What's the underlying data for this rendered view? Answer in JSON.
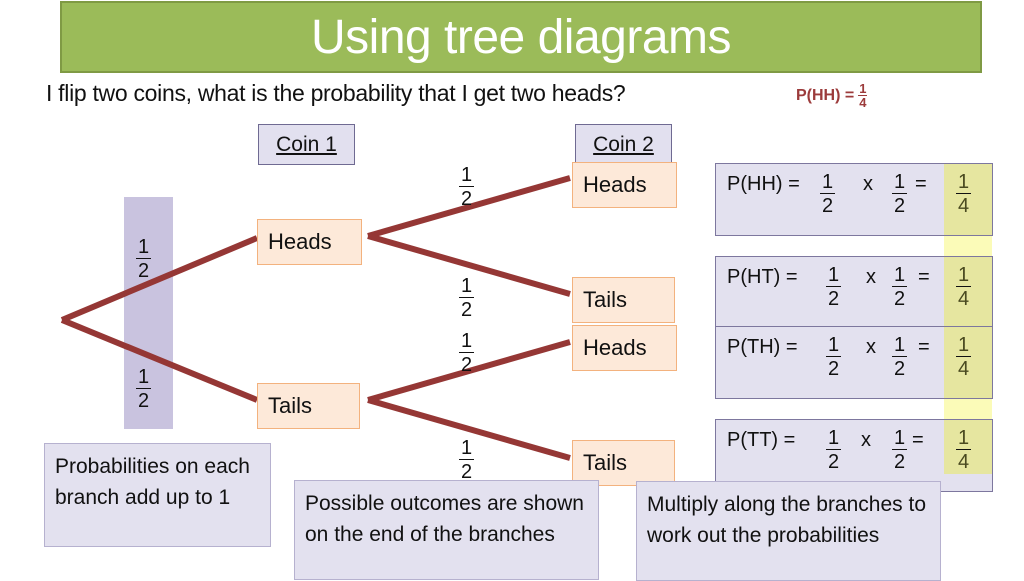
{
  "title": "Using tree diagrams",
  "question": "I flip two coins, what is the probability that I get two heads?",
  "answer": {
    "label": "P(HH) =",
    "numerator": "1",
    "denominator": "4"
  },
  "colors": {
    "banner": "#9bbb59",
    "branch": "#953735",
    "node_fill": "#fde9d9",
    "calc_fill": "#e3e1ef",
    "highlight": "#e6e6a0"
  },
  "coin_labels": {
    "coin1": "Coin 1",
    "coin2": "Coin 2"
  },
  "tree": {
    "first": [
      {
        "label": "Heads",
        "prob": {
          "n": "1",
          "d": "2"
        }
      },
      {
        "label": "Tails",
        "prob": {
          "n": "1",
          "d": "2"
        }
      }
    ],
    "second": [
      {
        "label": "Heads",
        "prob": {
          "n": "1",
          "d": "2"
        }
      },
      {
        "label": "Tails",
        "prob": {
          "n": "1",
          "d": "2"
        }
      },
      {
        "label": "Heads",
        "prob": {
          "n": "1",
          "d": "2"
        }
      },
      {
        "label": "Tails",
        "prob": {
          "n": "1",
          "d": "2"
        }
      }
    ]
  },
  "calculations": [
    {
      "label": "P(HH) =",
      "a": {
        "n": "1",
        "d": "2"
      },
      "op": "x",
      "b": {
        "n": "1",
        "d": "2"
      },
      "eq": "=",
      "result": {
        "n": "1",
        "d": "4"
      }
    },
    {
      "label": "P(HT) =",
      "a": {
        "n": "1",
        "d": "2"
      },
      "op": "x",
      "b": {
        "n": "1",
        "d": "2"
      },
      "eq": "=",
      "result": {
        "n": "1",
        "d": "4"
      }
    },
    {
      "label": "P(TH) =",
      "a": {
        "n": "1",
        "d": "2"
      },
      "op": "x",
      "b": {
        "n": "1",
        "d": "2"
      },
      "eq": "=",
      "result": {
        "n": "1",
        "d": "4"
      }
    },
    {
      "label": "P(TT) =",
      "a": {
        "n": "1",
        "d": "2"
      },
      "op": "x",
      "b": {
        "n": "1",
        "d": "2"
      },
      "eq": "=",
      "result": {
        "n": "1",
        "d": "4"
      }
    }
  ],
  "notes": {
    "branch_sum": "Probabilities on each branch add up to 1",
    "outcomes": "Possible outcomes are shown on the end of the branches",
    "multiply": "Multiply along the branches to work out the probabilities"
  }
}
